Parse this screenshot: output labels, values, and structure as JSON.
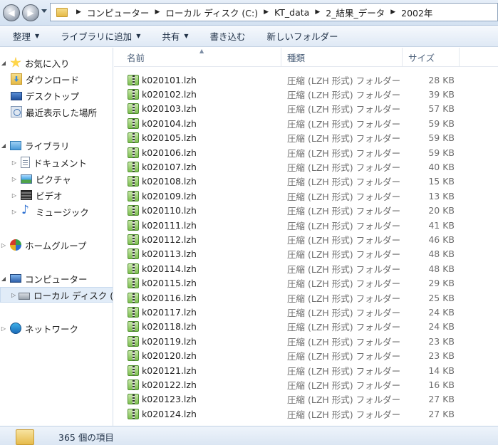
{
  "address": {
    "breadcrumbs": [
      "コンピューター",
      "ローカル ディスク (C:)",
      "KT_data",
      "2_結果_データ",
      "2002年"
    ]
  },
  "toolbar": {
    "organize": "整理",
    "add_to_library": "ライブラリに追加",
    "share": "共有",
    "burn": "書き込む",
    "new_folder": "新しいフォルダー"
  },
  "nav": {
    "favorites": "お気に入り",
    "downloads": "ダウンロード",
    "desktop": "デスクトップ",
    "recent": "最近表示した場所",
    "libraries": "ライブラリ",
    "documents": "ドキュメント",
    "pictures": "ピクチャ",
    "videos": "ビデオ",
    "music": "ミュージック",
    "homegroup": "ホームグループ",
    "computer": "コンピューター",
    "local_disk": "ローカル ディスク (",
    "network": "ネットワーク"
  },
  "columns": {
    "name": "名前",
    "type": "種類",
    "size": "サイズ"
  },
  "files": [
    {
      "name": "k020101.lzh",
      "type": "圧縮 (LZH 形式) フォルダー",
      "size": "28 KB"
    },
    {
      "name": "k020102.lzh",
      "type": "圧縮 (LZH 形式) フォルダー",
      "size": "39 KB"
    },
    {
      "name": "k020103.lzh",
      "type": "圧縮 (LZH 形式) フォルダー",
      "size": "57 KB"
    },
    {
      "name": "k020104.lzh",
      "type": "圧縮 (LZH 形式) フォルダー",
      "size": "59 KB"
    },
    {
      "name": "k020105.lzh",
      "type": "圧縮 (LZH 形式) フォルダー",
      "size": "59 KB"
    },
    {
      "name": "k020106.lzh",
      "type": "圧縮 (LZH 形式) フォルダー",
      "size": "59 KB"
    },
    {
      "name": "k020107.lzh",
      "type": "圧縮 (LZH 形式) フォルダー",
      "size": "40 KB"
    },
    {
      "name": "k020108.lzh",
      "type": "圧縮 (LZH 形式) フォルダー",
      "size": "15 KB"
    },
    {
      "name": "k020109.lzh",
      "type": "圧縮 (LZH 形式) フォルダー",
      "size": "13 KB"
    },
    {
      "name": "k020110.lzh",
      "type": "圧縮 (LZH 形式) フォルダー",
      "size": "20 KB"
    },
    {
      "name": "k020111.lzh",
      "type": "圧縮 (LZH 形式) フォルダー",
      "size": "41 KB"
    },
    {
      "name": "k020112.lzh",
      "type": "圧縮 (LZH 形式) フォルダー",
      "size": "46 KB"
    },
    {
      "name": "k020113.lzh",
      "type": "圧縮 (LZH 形式) フォルダー",
      "size": "48 KB"
    },
    {
      "name": "k020114.lzh",
      "type": "圧縮 (LZH 形式) フォルダー",
      "size": "48 KB"
    },
    {
      "name": "k020115.lzh",
      "type": "圧縮 (LZH 形式) フォルダー",
      "size": "29 KB"
    },
    {
      "name": "k020116.lzh",
      "type": "圧縮 (LZH 形式) フォルダー",
      "size": "25 KB"
    },
    {
      "name": "k020117.lzh",
      "type": "圧縮 (LZH 形式) フォルダー",
      "size": "24 KB"
    },
    {
      "name": "k020118.lzh",
      "type": "圧縮 (LZH 形式) フォルダー",
      "size": "24 KB"
    },
    {
      "name": "k020119.lzh",
      "type": "圧縮 (LZH 形式) フォルダー",
      "size": "23 KB"
    },
    {
      "name": "k020120.lzh",
      "type": "圧縮 (LZH 形式) フォルダー",
      "size": "23 KB"
    },
    {
      "name": "k020121.lzh",
      "type": "圧縮 (LZH 形式) フォルダー",
      "size": "14 KB"
    },
    {
      "name": "k020122.lzh",
      "type": "圧縮 (LZH 形式) フォルダー",
      "size": "16 KB"
    },
    {
      "name": "k020123.lzh",
      "type": "圧縮 (LZH 形式) フォルダー",
      "size": "27 KB"
    },
    {
      "name": "k020124.lzh",
      "type": "圧縮 (LZH 形式) フォルダー",
      "size": "27 KB"
    }
  ],
  "status": {
    "count_text": "365 個の項目"
  }
}
